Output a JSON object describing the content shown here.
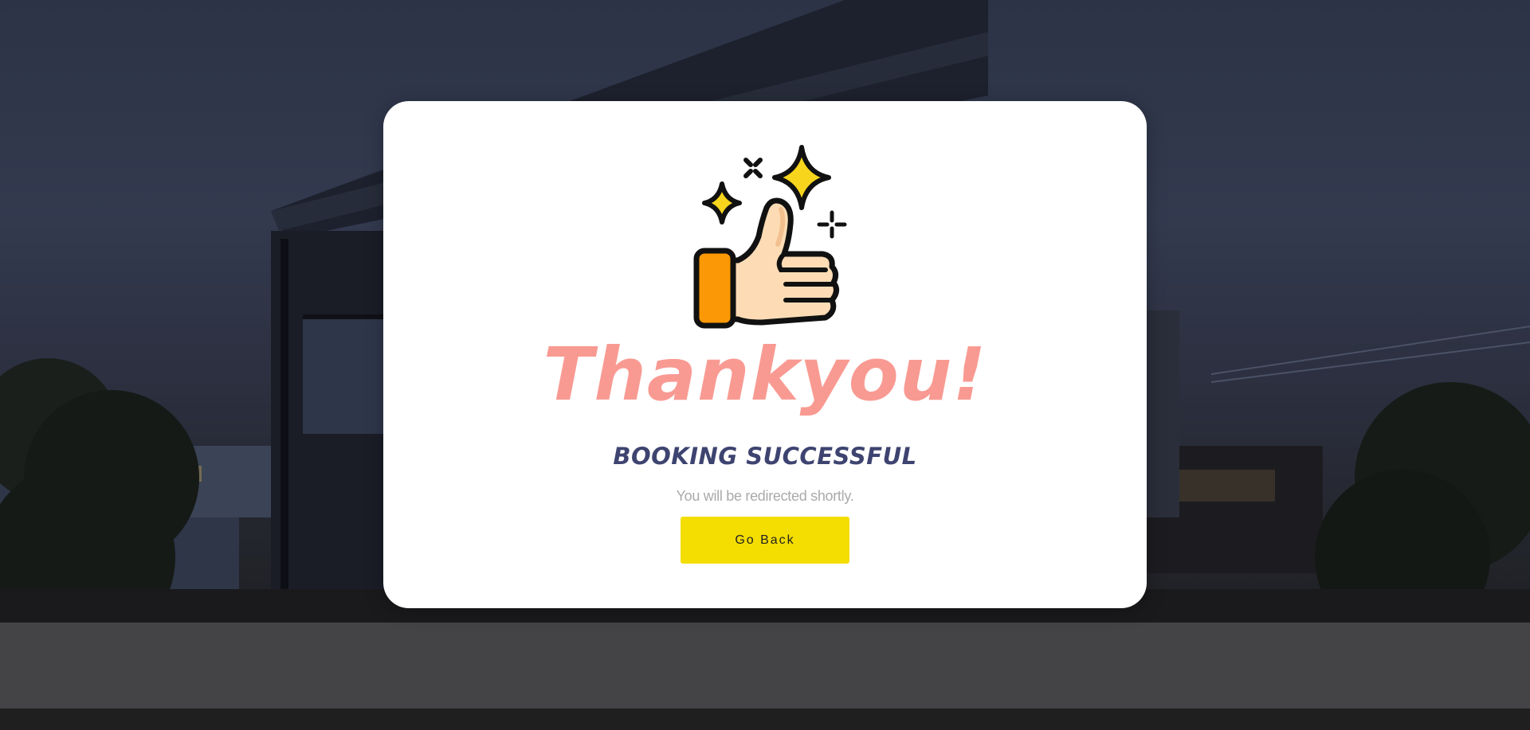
{
  "modal": {
    "icon": "thumbs-up-sparkles-icon",
    "title": "Thankyou!",
    "subtitle": "BOOKING SUCCESSFUL",
    "message": "You will be redirected shortly.",
    "button_label": "Go Back"
  },
  "colors": {
    "title": "#f99a92",
    "subtitle": "#3e4470",
    "message": "#aaaaaa",
    "button": "#f4dd00",
    "overlay": "#2c3346"
  }
}
